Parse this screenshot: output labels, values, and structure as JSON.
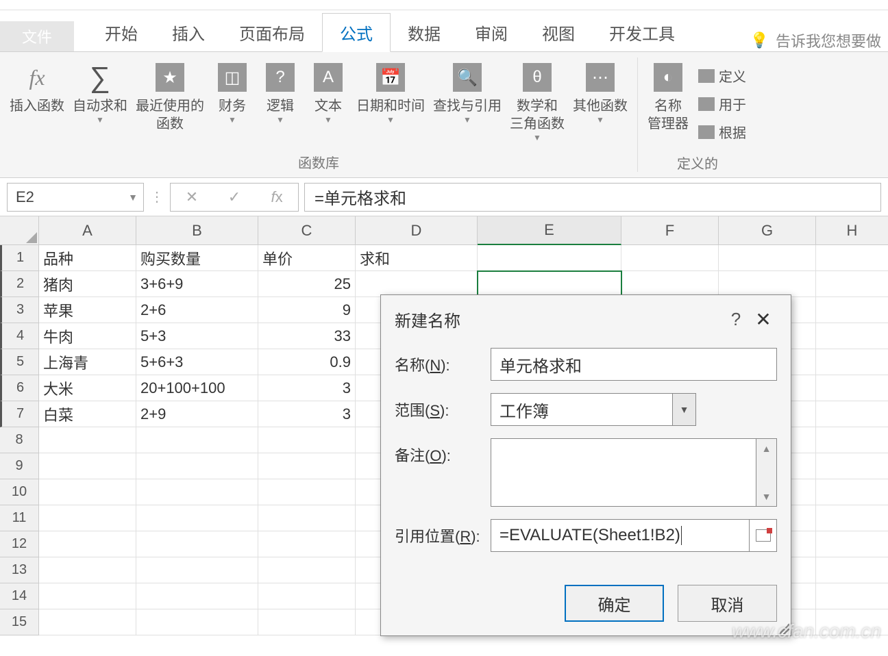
{
  "tabs": {
    "file": "文件",
    "home": "开始",
    "insert": "插入",
    "pageLayout": "页面布局",
    "formulas": "公式",
    "data": "数据",
    "review": "审阅",
    "view": "视图",
    "developer": "开发工具",
    "tellMe": "告诉我您想要做"
  },
  "ribbon": {
    "insertFunction": "插入函数",
    "autoSum": "自动求和",
    "recentlyUsed": "最近使用的\n函数",
    "financial": "财务",
    "logical": "逻辑",
    "text": "文本",
    "dateTime": "日期和时间",
    "lookupRef": "查找与引用",
    "mathTrig": "数学和\n三角函数",
    "moreFunctions": "其他函数",
    "functionLibrary": "函数库",
    "nameManager": "名称\n管理器",
    "defineName": "定义",
    "useInFormula": "用于",
    "createFromSelection": "根据",
    "definedNames": "定义的"
  },
  "formulaBar": {
    "nameBox": "E2",
    "formula": "=单元格求和"
  },
  "columns": [
    "A",
    "B",
    "C",
    "D",
    "E",
    "F",
    "G",
    "H"
  ],
  "activeCol": "E",
  "rowCount": 15,
  "activeCell": "E2",
  "headerRow": {
    "A": "品种",
    "B": "购买数量",
    "C": "单价",
    "D": "求和"
  },
  "dataRows": [
    {
      "A": "猪肉",
      "B": "3+6+9",
      "C": "25"
    },
    {
      "A": "苹果",
      "B": "2+6",
      "C": "9"
    },
    {
      "A": "牛肉",
      "B": "5+3",
      "C": "33"
    },
    {
      "A": "上海青",
      "B": "5+6+3",
      "C": "0.9"
    },
    {
      "A": "大米",
      "B": "20+100+100",
      "C": "3"
    },
    {
      "A": "白菜",
      "B": "2+9",
      "C": "3"
    }
  ],
  "dialog": {
    "title": "新建名称",
    "help": "?",
    "close": "✕",
    "nameLabel": "名称(N):",
    "nameValue": "单元格求和",
    "scopeLabel": "范围(S):",
    "scopeValue": "工作簿",
    "commentLabel": "备注(O):",
    "refLabel": "引用位置(R):",
    "refValue": "=EVALUATE(Sheet1!B2)",
    "ok": "确定",
    "cancel": "取消"
  },
  "watermark": "www.cfan.com.cn"
}
